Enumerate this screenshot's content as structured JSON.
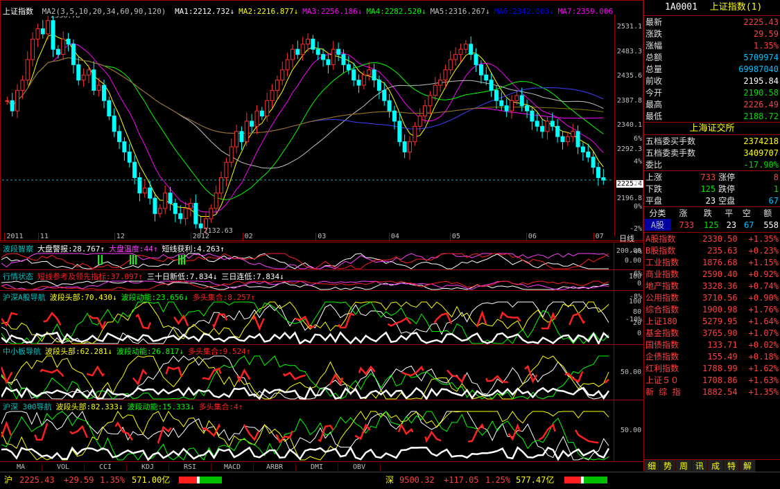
{
  "main_chart": {
    "title": "上证指数",
    "ma_label": "MA2(3,5,10,20,34,60,90,120)",
    "ma_values": [
      {
        "label": "MA1:2212.732",
        "color": "#ffffff"
      },
      {
        "label": "MA2:2216.877",
        "color": "#ffff00"
      },
      {
        "label": "MA3:2256.186",
        "color": "#ff00ff"
      },
      {
        "label": "MA4:2282.520",
        "color": "#00ff00"
      },
      {
        "label": "MA5:2316.267",
        "color": "#c0c0c0"
      },
      {
        "label": "MA6:2342.003",
        "color": "#0000ff"
      },
      {
        "label": "MA7:2359.006",
        "color": "#ff00ff"
      },
      {
        "label": "MA8:2336.830",
        "color": "#808000"
      }
    ],
    "high_label": "2536.78",
    "low_label": "2132.63",
    "current_price_tag": "2225.4",
    "price_ticks": [
      "2531.1",
      "2483.3",
      "2435.6",
      "2387.8",
      "2340.1",
      "2292.3",
      "2225.4",
      "2196.8"
    ],
    "pct_ticks": [
      "6%",
      "4%",
      "2%",
      "0%",
      "-2%",
      "-4%",
      "-6%",
      "-8%",
      "-10%"
    ],
    "date_ticks": [
      "2011",
      "11",
      "12",
      "2012",
      "02",
      "03",
      "04",
      "05",
      "06",
      "07"
    ],
    "period": "日线"
  },
  "chart_data": {
    "type": "candlestick",
    "ylim": [
      2120,
      2545
    ],
    "close": [
      2380,
      2360,
      2400,
      2420,
      2460,
      2500,
      2520,
      2510,
      2536,
      2480,
      2470,
      2500,
      2490,
      2450,
      2420,
      2430,
      2440,
      2400,
      2410,
      2380,
      2350,
      2320,
      2300,
      2280,
      2260,
      2230,
      2200,
      2210,
      2190,
      2160,
      2170,
      2200,
      2180,
      2160,
      2150,
      2170,
      2180,
      2140,
      2132,
      2150,
      2170,
      2200,
      2230,
      2260,
      2290,
      2320,
      2300,
      2340,
      2330,
      2360,
      2350,
      2380,
      2400,
      2420,
      2440,
      2460,
      2480,
      2470,
      2490,
      2500,
      2480,
      2470,
      2460,
      2450,
      2480,
      2470,
      2450,
      2440,
      2420,
      2410,
      2430,
      2440,
      2420,
      2400,
      2380,
      2360,
      2340,
      2300,
      2280,
      2300,
      2330,
      2350,
      2370,
      2390,
      2410,
      2420,
      2440,
      2460,
      2470,
      2480,
      2490,
      2470,
      2450,
      2430,
      2420,
      2400,
      2380,
      2370,
      2360,
      2380,
      2390,
      2370,
      2360,
      2340,
      2330,
      2320,
      2340,
      2330,
      2310,
      2300,
      2310,
      2320,
      2290,
      2280,
      2270,
      2250,
      2230,
      2225
    ]
  },
  "indicators": [
    {
      "title": "波段智察",
      "items": [
        {
          "text": "大盘警报:28.767↑",
          "color": "#ffffff"
        },
        {
          "text": "大盘温度:44↑",
          "color": "#ff40ff"
        },
        {
          "text": "短线获利:4.263↑",
          "color": "#ffffff"
        }
      ],
      "ticks": [
        "200.00",
        "0.00"
      ]
    },
    {
      "title": "行情状态",
      "items": [
        {
          "text": "短线参考及领先指标:37.097↑",
          "color": "#ff2020"
        },
        {
          "text": "三十日新低:7.834↓",
          "color": "#ffffff"
        },
        {
          "text": "三日连低:7.834↓",
          "color": "#ffffff"
        }
      ],
      "ticks": [
        "100",
        "0"
      ]
    },
    {
      "title": "沪深A股导航",
      "items": [
        {
          "text": "波段头部:70.430↓",
          "color": "#ffff00"
        },
        {
          "text": "波段动能:23.656↓",
          "color": "#00ff00"
        },
        {
          "text": "多头集合:8.257↑",
          "color": "#ff2020"
        }
      ],
      "ticks": [
        "100",
        "80",
        "20",
        "0"
      ]
    },
    {
      "title": "中小板导航",
      "items": [
        {
          "text": "波段头部:62.281↓",
          "color": "#ffff00"
        },
        {
          "text": "波段动能:26.817↓",
          "color": "#00ff00"
        },
        {
          "text": "多头集合:9.524↑",
          "color": "#ff2020"
        }
      ],
      "ticks": [
        "50.00"
      ]
    },
    {
      "title": "沪深 300导航",
      "items": [
        {
          "text": "波段头部:82.333↓",
          "color": "#ffff00"
        },
        {
          "text": "波段动能:15.333↓",
          "color": "#00ff00"
        },
        {
          "text": "多头集合:4↑",
          "color": "#ff2020"
        }
      ],
      "ticks": [
        "50.00"
      ]
    }
  ],
  "bottom_tabs": [
    "MA",
    "VOL",
    "CCI",
    "KDJ",
    "RSI",
    "MACD",
    "ARBR",
    "DMI",
    "OBV"
  ],
  "right_panel": {
    "code": "1A0001",
    "name": "上证指数(1)",
    "rows": [
      {
        "label": "最新",
        "value": "2225.43",
        "cls": "red"
      },
      {
        "label": "涨跌",
        "value": "29.59",
        "cls": "red"
      },
      {
        "label": "涨幅",
        "value": "1.35%",
        "cls": "red"
      },
      {
        "label": "总额",
        "value": "5709974",
        "cls": "cyn"
      },
      {
        "label": "总量",
        "value": "69987040",
        "cls": "cyn"
      },
      {
        "label": "前收",
        "value": "2195.84",
        "cls": "wht"
      },
      {
        "label": "今开",
        "value": "2190.58",
        "cls": "grn"
      },
      {
        "label": "最高",
        "value": "2226.49",
        "cls": "red"
      },
      {
        "label": "最低",
        "value": "2188.72",
        "cls": "grn"
      }
    ],
    "exchange": "上海证交所",
    "bid_ask": [
      {
        "label": "五档委买手数",
        "value": "2374218",
        "cls": "yel"
      },
      {
        "label": "五档委卖手数",
        "value": "3409707",
        "cls": "yel"
      },
      {
        "label": "委比",
        "value": "-17.90%",
        "cls": "grn"
      }
    ],
    "breadth": {
      "up_label": "上涨",
      "up": "733",
      "limit_up_label": "涨停",
      "limit_up": "8",
      "down_label": "下跌",
      "down": "125",
      "limit_down_label": "跌停",
      "limit_down": "1",
      "flat_label": "平盘",
      "flat": "23",
      "empty_label": "空盘",
      "empty": "67"
    },
    "class_header": [
      "分类",
      "涨",
      "跌",
      "平",
      "空",
      "额"
    ],
    "class_row": {
      "name": "A股",
      "up": "733",
      "down": "125",
      "flat": "23",
      "empty": "67",
      "amount": "558"
    },
    "indices": [
      {
        "name": "A股指数",
        "value": "2330.50",
        "chg": "+1.35%"
      },
      {
        "name": "B股指数",
        "value": "235.63",
        "chg": "+0.23%"
      },
      {
        "name": "工业指数",
        "value": "1876.68",
        "chg": "+1.15%"
      },
      {
        "name": "商业指数",
        "value": "2590.40",
        "chg": "+0.92%"
      },
      {
        "name": "地产指数",
        "value": "3328.36",
        "chg": "+0.74%"
      },
      {
        "name": "公用指数",
        "value": "3710.56",
        "chg": "+0.90%"
      },
      {
        "name": "综合指数",
        "value": "1900.98",
        "chg": "+1.76%"
      },
      {
        "name": "上证180",
        "value": "5279.95",
        "chg": "+1.64%"
      },
      {
        "name": "基金指数",
        "value": "3765.90",
        "chg": "+1.07%"
      },
      {
        "name": "国债指数",
        "value": "133.71",
        "chg": "+0.02%"
      },
      {
        "name": "企债指数",
        "value": "155.49",
        "chg": "+0.18%"
      },
      {
        "name": "红利指数",
        "value": "1788.99",
        "chg": "+1.62%"
      },
      {
        "name": "上证５０",
        "value": "1708.86",
        "chg": "+1.63%"
      },
      {
        "name": "新 综 指",
        "value": "1882.54",
        "chg": "+1.35%"
      }
    ],
    "tabs": [
      "细",
      "势",
      "周",
      "讯",
      "成",
      "特",
      "解"
    ]
  },
  "status_bar": {
    "sh_label": "沪",
    "sh_value": "2225.43",
    "sh_change": "+29.59",
    "sh_pct": "1.35%",
    "sh_amount": "571.00亿",
    "sz_label": "深",
    "sz_value": "9500.32",
    "sz_change": "+117.05",
    "sz_pct": "1.25%",
    "sz_amount": "577.47亿"
  }
}
